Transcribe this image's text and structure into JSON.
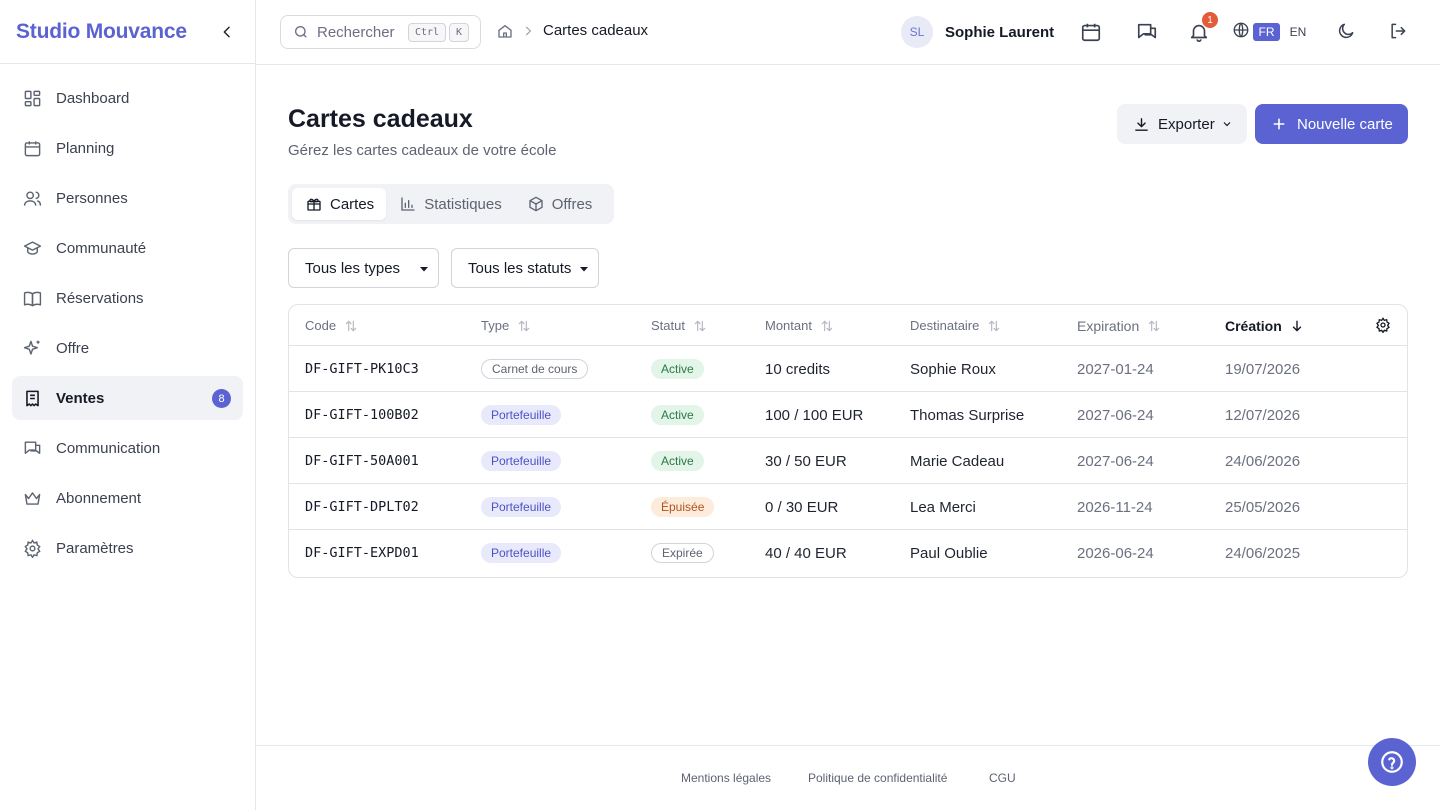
{
  "brand": {
    "name": "Studio Mouvance",
    "accent": "#5b63d3"
  },
  "sidebar": {
    "items": [
      {
        "label": "Dashboard",
        "icon": "dashboard-icon"
      },
      {
        "label": "Planning",
        "icon": "calendar-icon"
      },
      {
        "label": "Personnes",
        "icon": "users-icon"
      },
      {
        "label": "Communauté",
        "icon": "graduation-cap-icon"
      },
      {
        "label": "Réservations",
        "icon": "book-icon"
      },
      {
        "label": "Offre",
        "icon": "sparkles-icon"
      },
      {
        "label": "Ventes",
        "icon": "receipt-icon",
        "badge": "8",
        "active": true
      },
      {
        "label": "Communication",
        "icon": "chat-icon"
      },
      {
        "label": "Abonnement",
        "icon": "crown-icon"
      },
      {
        "label": "Paramètres",
        "icon": "gear-icon"
      }
    ]
  },
  "topbar": {
    "search_placeholder": "Rechercher",
    "kbd_ctrl": "Ctrl",
    "kbd_k": "K",
    "breadcrumb_current": "Cartes cadeaux",
    "user_initials": "SL",
    "user_name": "Sophie Laurent",
    "notification_count": "1",
    "lang_fr": "FR",
    "lang_en": "EN"
  },
  "page": {
    "title": "Cartes cadeaux",
    "subtitle": "Gérez les cartes cadeaux de votre école",
    "export_label": "Exporter",
    "new_label": "Nouvelle carte"
  },
  "tabs": [
    {
      "label": "Cartes",
      "icon": "gift-icon",
      "active": true
    },
    {
      "label": "Statistiques",
      "icon": "bar-chart-icon"
    },
    {
      "label": "Offres",
      "icon": "package-icon"
    }
  ],
  "filters": {
    "type_selected": "Tous les types",
    "status_selected": "Tous les statuts"
  },
  "table": {
    "headers": {
      "code": "Code",
      "type": "Type",
      "status": "Statut",
      "amount": "Montant",
      "recipient": "Destinataire",
      "expiration": "Expiration",
      "creation": "Création"
    },
    "rows": [
      {
        "code": "DF-GIFT-PK10C3",
        "type": "Carnet de cours",
        "status": "Active",
        "amount": "10 credits",
        "recipient": "Sophie Roux",
        "expiration": "2027-01-24",
        "creation": "19/07/2026"
      },
      {
        "code": "DF-GIFT-100B02",
        "type": "Portefeuille",
        "status": "Active",
        "amount": "100 / 100 EUR",
        "recipient": "Thomas Surprise",
        "expiration": "2027-06-24",
        "creation": "12/07/2026"
      },
      {
        "code": "DF-GIFT-50A001",
        "type": "Portefeuille",
        "status": "Active",
        "amount": "30 / 50 EUR",
        "recipient": "Marie Cadeau",
        "expiration": "2027-06-24",
        "creation": "24/06/2026"
      },
      {
        "code": "DF-GIFT-DPLT02",
        "type": "Portefeuille",
        "status": "Épuisée",
        "amount": "0 / 30 EUR",
        "recipient": "Lea Merci",
        "expiration": "2026-11-24",
        "creation": "25/05/2026"
      },
      {
        "code": "DF-GIFT-EXPD01",
        "type": "Portefeuille",
        "status": "Expirée",
        "amount": "40 / 40 EUR",
        "recipient": "Paul Oublie",
        "expiration": "2026-06-24",
        "creation": "24/06/2025"
      }
    ]
  },
  "footer": {
    "legal": "Mentions légales",
    "privacy": "Politique de confidentialité",
    "terms": "CGU"
  }
}
